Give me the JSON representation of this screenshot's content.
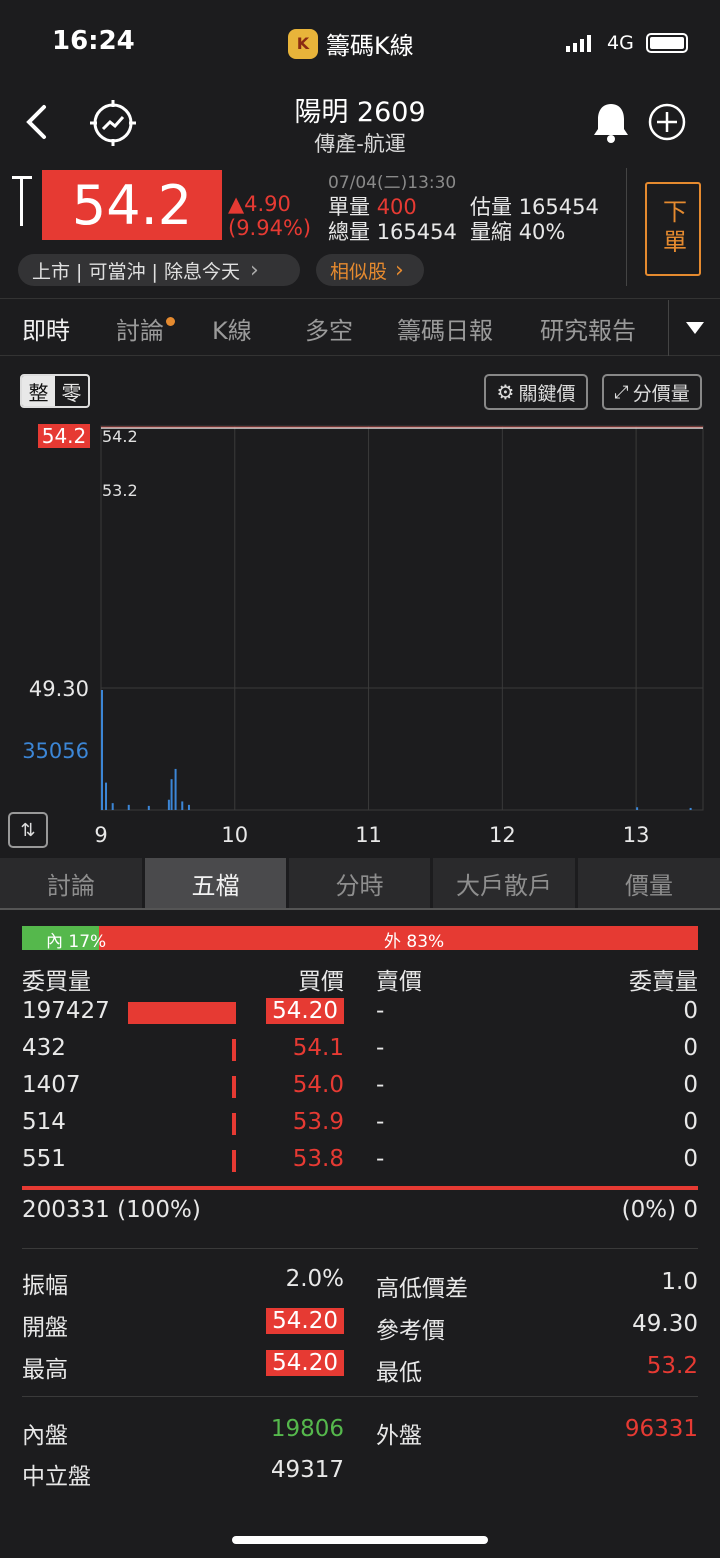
{
  "status_bar": {
    "time": "16:24",
    "app_name": "籌碼K線",
    "network": "4G"
  },
  "header": {
    "stock_name": "陽明 2609",
    "category": "傳產-航運"
  },
  "quote": {
    "price": "54.2",
    "change": "▲4.90",
    "change_pct": "(9.94%)",
    "datetime": "07/04(二)13:30",
    "unit_vol_label": "單量",
    "unit_vol": "400",
    "est_vol_label": "估量",
    "est_vol": "165454",
    "total_vol_label": "總量",
    "total_vol": "165454",
    "vol_ratio_label": "量縮",
    "vol_ratio": "40%",
    "order_button": "下單",
    "tags": "上市 | 可當沖 | 除息今天",
    "tags_arrow": "›",
    "similar": "相似股",
    "similar_arrow": "›"
  },
  "tabs": [
    {
      "label": "即時",
      "active": true
    },
    {
      "label": "討論",
      "active": false,
      "dot": true
    },
    {
      "label": "K線",
      "active": false
    },
    {
      "label": "多空",
      "active": false
    },
    {
      "label": "籌碼日報",
      "active": false
    },
    {
      "label": "研究報告",
      "active": false
    }
  ],
  "chart_controls": {
    "toggle_whole": "整",
    "toggle_odd": "零",
    "key_price": "關鍵價",
    "price_volume": "分價量"
  },
  "chart_data": {
    "type": "line",
    "price_series": {
      "x": [
        9.0,
        9.02,
        9.5,
        10.0,
        11.0,
        12.0,
        13.0,
        13.5
      ],
      "y": [
        54.2,
        54.2,
        54.2,
        54.2,
        54.2,
        54.2,
        54.2,
        54.2
      ]
    },
    "reference_price": 49.3,
    "top_label": "54.2",
    "high_label": "54.2",
    "low_label": "53.2",
    "ref_label": "49.30",
    "volume_max_label": "35056",
    "volume_series": {
      "x": [
        9.0,
        9.03,
        9.08,
        9.2,
        9.35,
        9.5,
        9.52,
        9.55,
        9.6,
        9.65,
        13.0,
        13.4
      ],
      "y": [
        35056,
        8000,
        2000,
        1500,
        1200,
        3000,
        9000,
        12000,
        2500,
        1500,
        800,
        600
      ]
    },
    "x_ticks": [
      "9",
      "10",
      "11",
      "12",
      "13"
    ],
    "x_range": [
      9,
      13.5
    ]
  },
  "subtabs": [
    {
      "label": "討論",
      "active": false
    },
    {
      "label": "五檔",
      "active": true
    },
    {
      "label": "分時",
      "active": false
    },
    {
      "label": "大戶散戶",
      "active": false
    },
    {
      "label": "價量",
      "active": false
    }
  ],
  "order_book": {
    "inner_pct_label": "內 17%",
    "outer_pct_label": "外 83%",
    "inner_pct": 0.17,
    "headers": {
      "bid_vol": "委買量",
      "bid": "買價",
      "ask": "賣價",
      "ask_vol": "委賣量"
    },
    "rows": [
      {
        "bid_vol": "197427",
        "bid": "54.20",
        "ask": "-",
        "ask_vol": "0",
        "bar": 1.0,
        "boxed": true
      },
      {
        "bid_vol": "432",
        "bid": "54.1",
        "ask": "-",
        "ask_vol": "0",
        "bar": 0.0022,
        "boxed": false
      },
      {
        "bid_vol": "1407",
        "bid": "54.0",
        "ask": "-",
        "ask_vol": "0",
        "bar": 0.0071,
        "boxed": false
      },
      {
        "bid_vol": "514",
        "bid": "53.9",
        "ask": "-",
        "ask_vol": "0",
        "bar": 0.0026,
        "boxed": false
      },
      {
        "bid_vol": "551",
        "bid": "53.8",
        "ask": "-",
        "ask_vol": "0",
        "bar": 0.0028,
        "boxed": false
      }
    ],
    "bid_total": "200331 (100%)",
    "ask_total": "(0%) 0"
  },
  "stats": {
    "amplitude_label": "振幅",
    "amplitude": "2.0%",
    "hl_diff_label": "高低價差",
    "hl_diff": "1.0",
    "open_label": "開盤",
    "open": "54.20",
    "ref_label": "參考價",
    "ref": "49.30",
    "high_label": "最高",
    "high": "54.20",
    "low_label": "最低",
    "low": "53.2",
    "inner_label": "內盤",
    "inner": "19806",
    "outer_label": "外盤",
    "outer": "96331",
    "neutral_label": "中立盤",
    "neutral": "49317"
  },
  "colors": {
    "up": "#e63a33",
    "down": "#55b84c",
    "accent": "#e58a2f",
    "volume": "#3c86d6"
  }
}
